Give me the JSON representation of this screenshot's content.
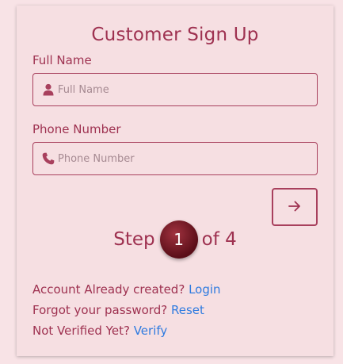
{
  "form": {
    "title": "Customer Sign Up",
    "full_name": {
      "label": "Full Name",
      "placeholder": "Full Name",
      "value": ""
    },
    "phone": {
      "label": "Phone Number",
      "placeholder": "Phone Number",
      "value": ""
    },
    "next_icon": "arrow-right-icon"
  },
  "stepper": {
    "prefix": "Step",
    "current": "1",
    "suffix": "of 4"
  },
  "links": {
    "login": {
      "text": "Account Already created?",
      "link": "Login"
    },
    "reset": {
      "text": "Forgot your password?",
      "link": "Reset"
    },
    "verify": {
      "text": "Not Verified Yet?",
      "link": "Verify"
    }
  },
  "colors": {
    "accent": "#9e3150",
    "link": "#2f7be0",
    "card": "#f6dfe2",
    "badge": "#7a1a26"
  }
}
